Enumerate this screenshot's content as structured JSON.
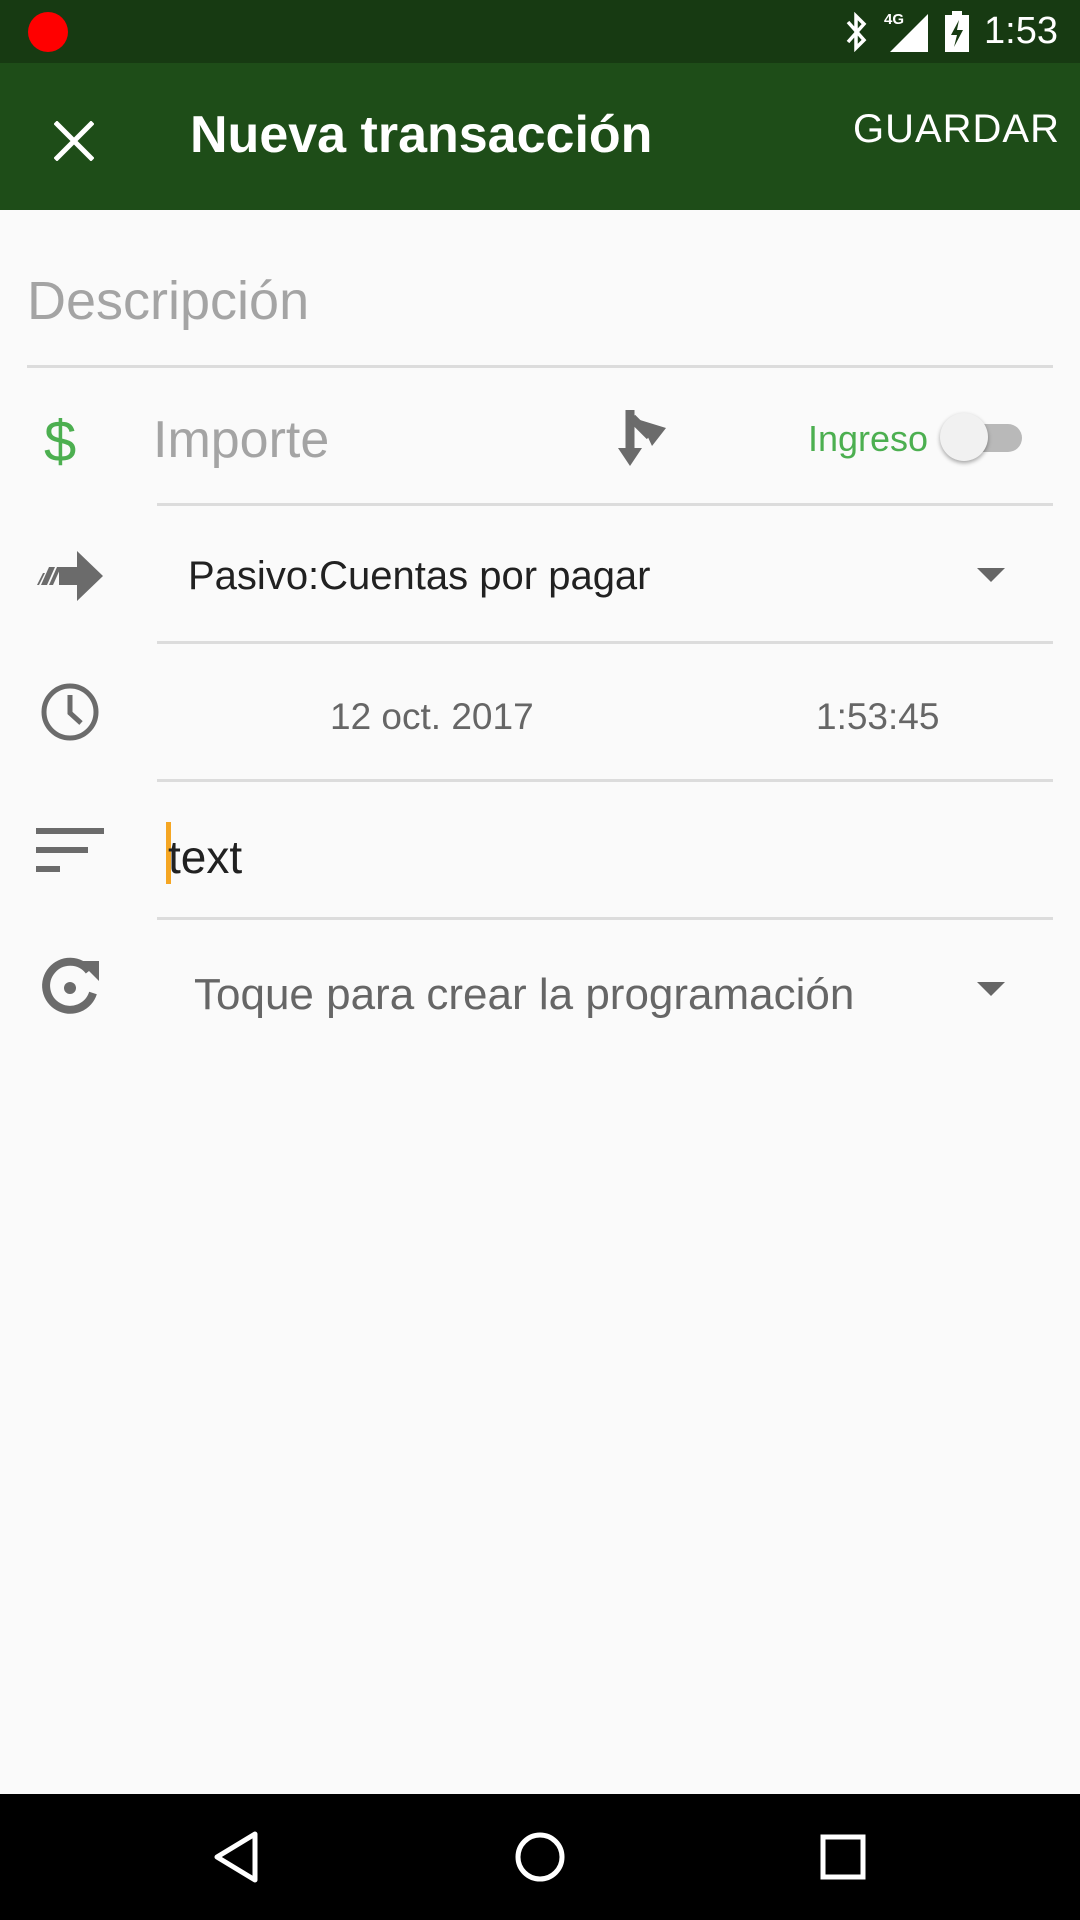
{
  "status_bar": {
    "time": "1:53",
    "network": "4G",
    "icons": [
      "recording-indicator",
      "bluetooth-icon",
      "signal-icon",
      "battery-charging-icon"
    ]
  },
  "app_bar": {
    "title": "Nueva transacción",
    "save_label": "GUARDAR",
    "close_icon": "close-icon"
  },
  "form": {
    "description_placeholder": "Descripción",
    "currency_symbol": "$",
    "amount_placeholder": "Importe",
    "income_label": "Ingreso",
    "income_toggle_on": false,
    "account": "Pasivo:Cuentas por pagar",
    "date": "12 oct. 2017",
    "time": "1:53:45",
    "notes_value": "text",
    "recurrence_placeholder": "Toque para crear la programación"
  },
  "colors": {
    "status_bar": "#173a12",
    "app_bar": "#1e4d18",
    "accent_green": "#4caf50",
    "cursor": "#f5a623"
  },
  "nav_bar": {
    "icons": [
      "back-icon",
      "home-icon",
      "recents-icon"
    ]
  }
}
